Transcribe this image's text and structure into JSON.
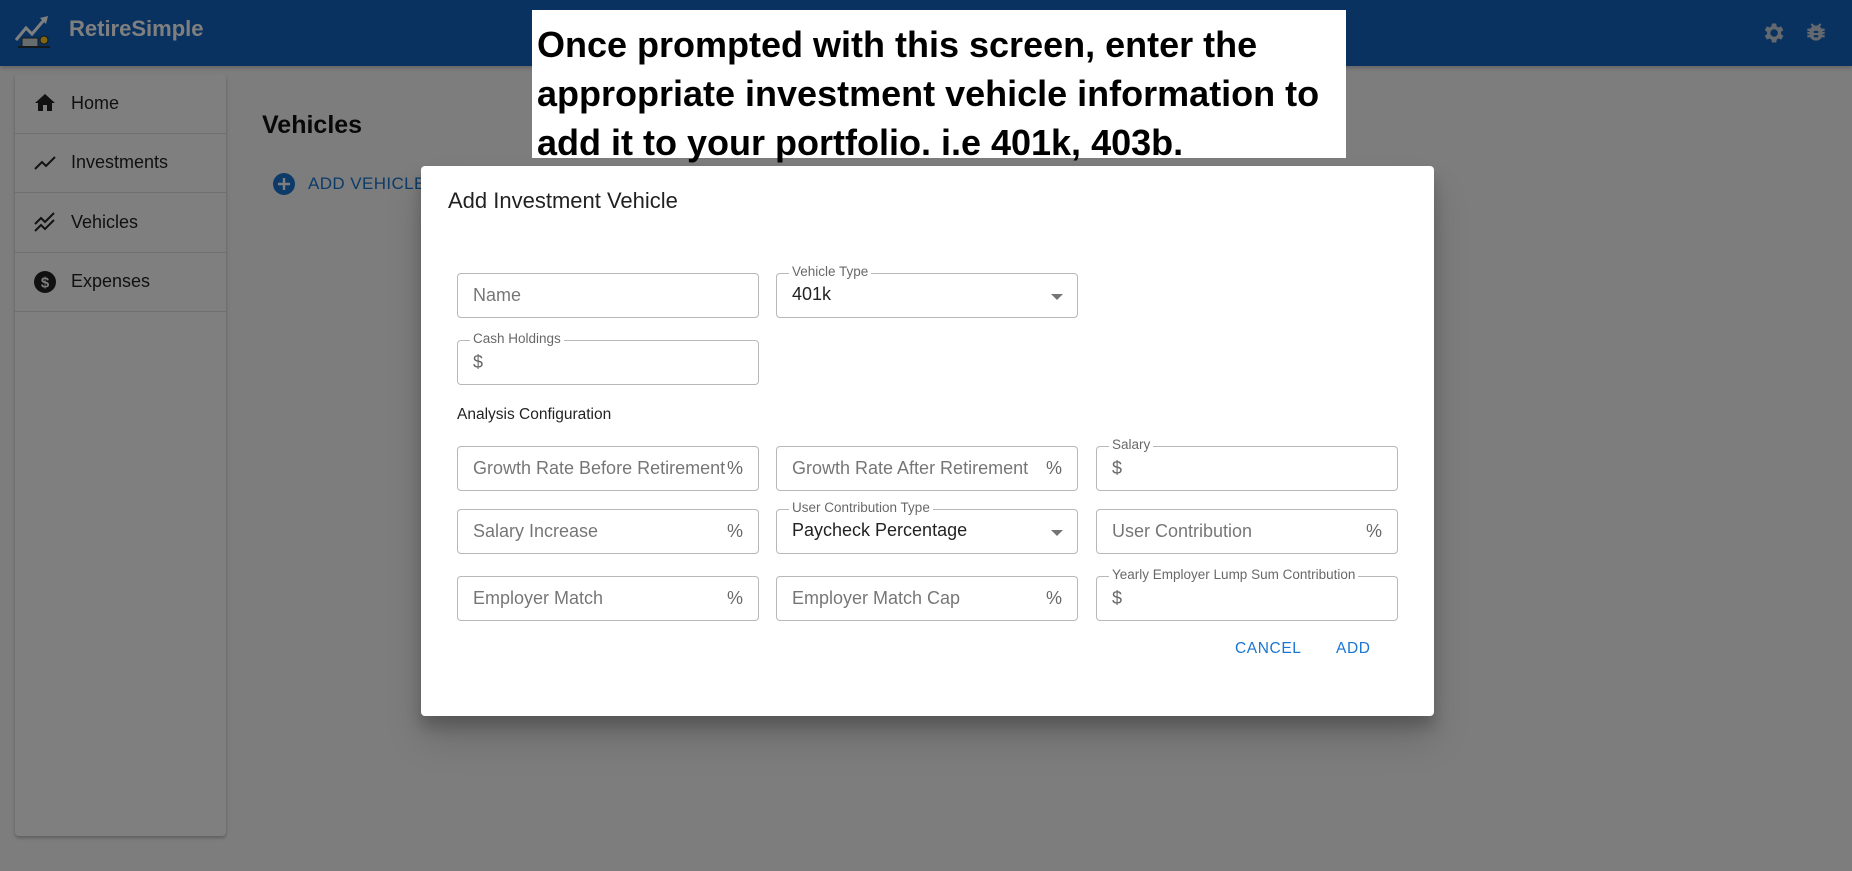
{
  "appbar": {
    "title": "RetireSimple",
    "icons": [
      "logo-icon",
      "gear-icon",
      "bug-icon"
    ]
  },
  "sidebar": {
    "items": [
      {
        "label": "Home",
        "icon": "home-icon"
      },
      {
        "label": "Investments",
        "icon": "trending-up-icon"
      },
      {
        "label": "Vehicles",
        "icon": "multiline-chart-icon"
      },
      {
        "label": "Expenses",
        "icon": "dollar-circle-icon"
      }
    ]
  },
  "main": {
    "title": "Vehicles",
    "add_button": "ADD VEHICLE"
  },
  "banner": {
    "text": "Once prompted with this screen, enter the appropriate investment vehicle information to add it to your portfolio. i.e 401k, 403b."
  },
  "dialog": {
    "title": "Add Investment Vehicle",
    "name": {
      "placeholder": "Name"
    },
    "vehicle_type": {
      "label": "Vehicle Type",
      "value": "401k"
    },
    "cash_holdings": {
      "label": "Cash Holdings",
      "prefix": "$"
    },
    "section_label": "Analysis Configuration",
    "growth_before": {
      "placeholder": "Growth Rate Before Retirement",
      "suffix": "%"
    },
    "growth_after": {
      "placeholder": "Growth Rate After Retirement",
      "suffix": "%"
    },
    "salary": {
      "label": "Salary",
      "prefix": "$"
    },
    "salary_increase": {
      "placeholder": "Salary Increase",
      "suffix": "%"
    },
    "user_contribution_type": {
      "label": "User Contribution Type",
      "value": "Paycheck Percentage"
    },
    "user_contribution": {
      "placeholder": "User Contribution",
      "suffix": "%"
    },
    "employer_match": {
      "placeholder": "Employer Match",
      "suffix": "%"
    },
    "employer_match_cap": {
      "placeholder": "Employer Match Cap",
      "suffix": "%"
    },
    "employer_lump_sum": {
      "label": "Yearly Employer Lump Sum Contribution",
      "prefix": "$"
    },
    "cancel_label": "CANCEL",
    "add_label": "ADD"
  },
  "colors": {
    "primary": "#1565c0",
    "accent": "#1976d2"
  }
}
